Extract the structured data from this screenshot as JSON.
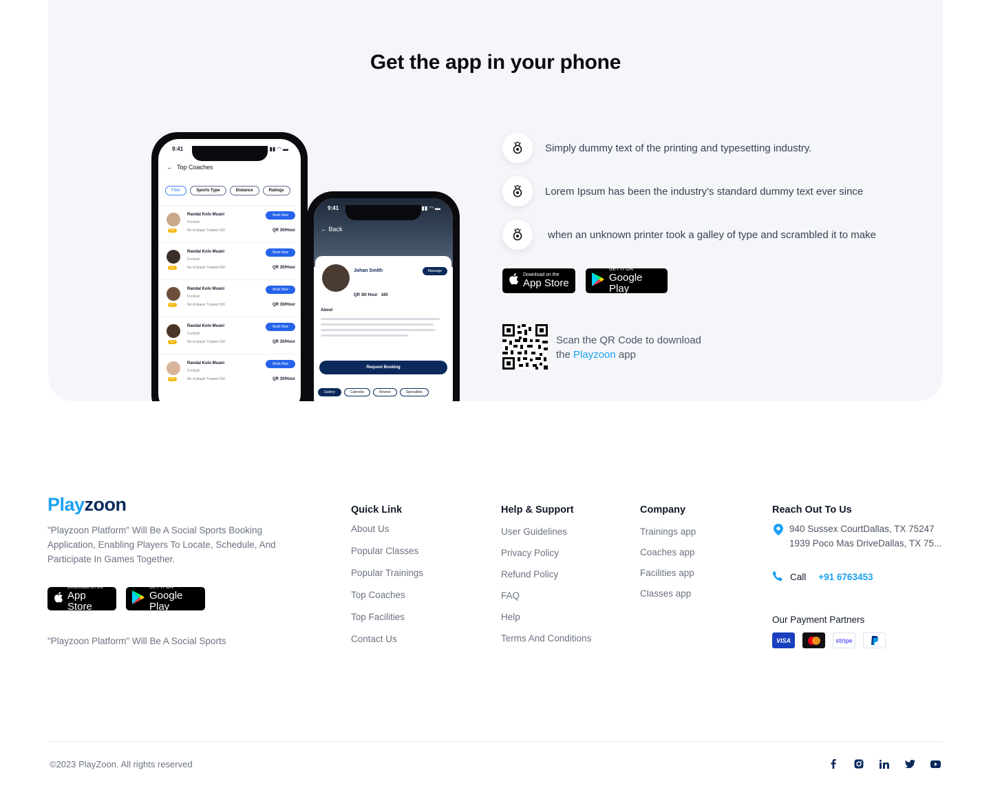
{
  "promo": {
    "title": "Get the app in your phone",
    "features": [
      "Simply dummy text of the printing and typesetting industry.",
      "Lorem Ipsum has been the industry's standard dummy text ever since",
      "when an unknown printer took a galley of type and scrambled it to make"
    ],
    "feature_icon": "medal-icon",
    "app_store": {
      "small": "Download on the",
      "big": "App Store"
    },
    "google_play": {
      "small": "GET IT ON",
      "big": "Google Play"
    },
    "qr": {
      "line1": "Scan the QR Code to download",
      "line2_prefix": "the ",
      "brand": "Playzoon",
      "line2_suffix": " app"
    },
    "phone1": {
      "time": "9:41",
      "header": "Top Coaches",
      "filters": [
        "Filter",
        "Sports Type",
        "Distance",
        "Ratings"
      ],
      "coaches": [
        {
          "name": "Randal Kolo Muani",
          "sport": "Football",
          "trained": "No of player Trained 160",
          "price": "QR 30/Hour",
          "rating": "4.5",
          "book": "Book Now"
        },
        {
          "name": "Randal Kolo Muani",
          "sport": "Football",
          "trained": "No of player Trained 160",
          "price": "QR 30/Hour",
          "rating": "4.1",
          "book": "Book Now"
        },
        {
          "name": "Randal Kolo Muani",
          "sport": "Football",
          "trained": "No of player Trained 160",
          "price": "QR 30/Hour",
          "rating": "4.1",
          "book": "Book Now"
        },
        {
          "name": "Randal Kolo Muani",
          "sport": "Football",
          "trained": "No of player Trained 160",
          "price": "QR 30/Hour",
          "rating": "4.2",
          "book": "Book Now"
        },
        {
          "name": "Randal Kolo Muani",
          "sport": "Football",
          "trained": "No of player Trained 160",
          "price": "QR 30/Hour",
          "rating": "4.5",
          "book": "Book Now"
        }
      ]
    },
    "phone2": {
      "time": "9:41",
      "back": "Back",
      "name": "Johan Smith",
      "message": "Massage",
      "price": "QR 30/ Hour",
      "trained": "160",
      "about": "About",
      "request": "Request Booking",
      "tabs": [
        "Gallery",
        "Calendar",
        "Review",
        "Specialties"
      ]
    }
  },
  "footer": {
    "logo_part1": "Play",
    "logo_part2": "zoon",
    "about": "\"Playzoon Platform\" Will Be A Social Sports Booking Application, Enabling Players To Locate, Schedule, And Participate In Games Together.",
    "app_store": {
      "small": "Download on the",
      "big": "App Store"
    },
    "google_play": {
      "small": "GET IT ON",
      "big": "Google Play"
    },
    "tagline": "\"Playzoon Platform\" Will Be A Social Sports",
    "quick_link": {
      "title": "Quick Link",
      "links": [
        "About Us",
        "Popular Classes",
        "Popular Trainings",
        "Top Coaches",
        "Top Facilities",
        "Contact Us"
      ]
    },
    "help": {
      "title": "Help & Support",
      "links": [
        "User Guidelines",
        "Privacy Policy",
        "Refund Policy",
        "FAQ",
        "Help",
        "Terms And Conditions"
      ]
    },
    "company": {
      "title": "Company",
      "links": [
        "Trainings app",
        "Coaches app",
        "Facilities app",
        "Classes app"
      ]
    },
    "reach": {
      "title": "Reach Out To Us",
      "address1": "940 Sussex CourtDallas, TX 75247",
      "address2": "1939 Poco Mas DriveDallas, TX 75...",
      "call_label": "Call",
      "phone": "+91 6763453",
      "payment_title": "Our Payment Partners",
      "payments": [
        "VISA",
        "mastercard",
        "stripe",
        "PayPal"
      ]
    },
    "copyright": "©2023 PlayZoon. All rights reserved",
    "socials": [
      "facebook-icon",
      "instagram-icon",
      "linkedin-icon",
      "twitter-icon",
      "youtube-icon"
    ]
  },
  "colors": {
    "accent": "#1da1f2",
    "navy": "#0b2a5b",
    "promo_bg": "#f4f6fa",
    "muted": "#6b7280"
  }
}
